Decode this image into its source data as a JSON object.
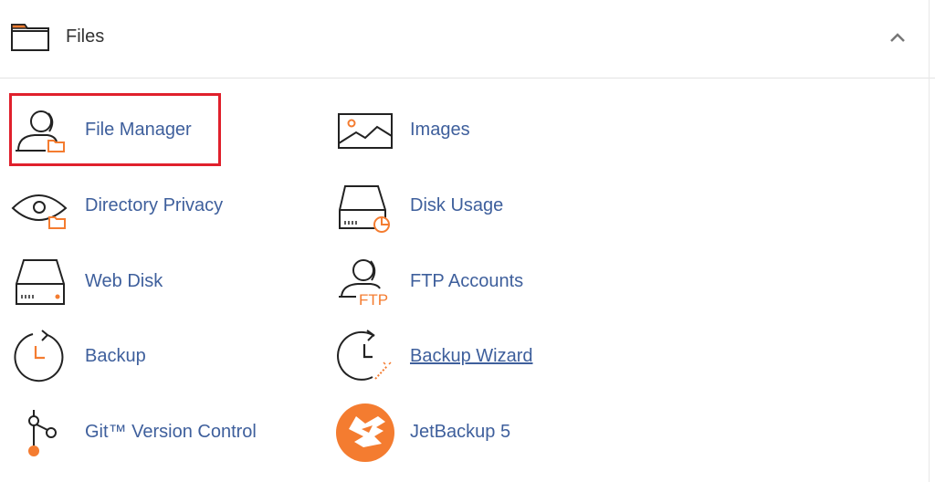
{
  "section": {
    "title": "Files",
    "icon": "folder-icon",
    "collapse_icon": "chevron-up-icon"
  },
  "items": [
    {
      "label": "File Manager",
      "icon": "file-manager-icon"
    },
    {
      "label": "Images",
      "icon": "image-icon"
    },
    {
      "label": "Directory Privacy",
      "icon": "directory-privacy-icon"
    },
    {
      "label": "Disk Usage",
      "icon": "disk-usage-icon"
    },
    {
      "label": "Web Disk",
      "icon": "web-disk-icon"
    },
    {
      "label": "FTP Accounts",
      "icon": "ftp-accounts-icon",
      "icon_text": "FTP"
    },
    {
      "label": "Backup",
      "icon": "backup-icon"
    },
    {
      "label": "Backup Wizard",
      "icon": "backup-wizard-icon"
    },
    {
      "label": "Git™ Version Control",
      "icon": "git-icon"
    },
    {
      "label": "JetBackup 5",
      "icon": "jetbackup-icon"
    }
  ],
  "colors": {
    "link": "#3e5f9c",
    "accent": "#f47c30",
    "highlight": "#e0202c"
  }
}
